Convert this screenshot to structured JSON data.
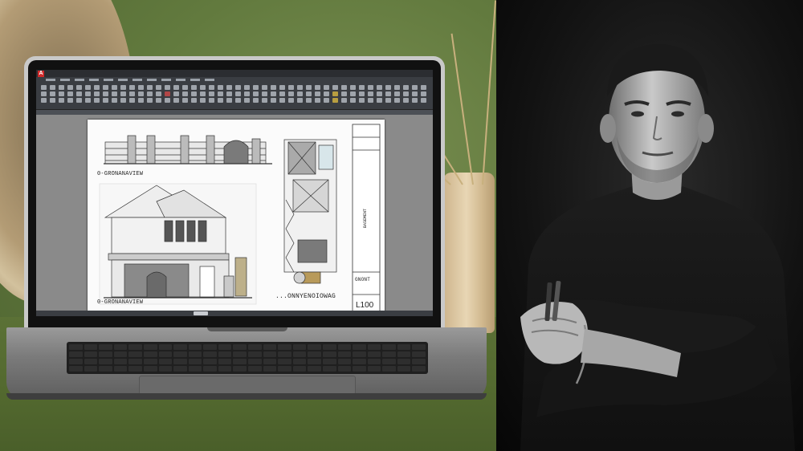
{
  "screen": {
    "app_logo": "A",
    "sheet": {
      "elevation_top_label": "0-GRONANAVIEW",
      "elevation_front_label": "0-GRONANAVIEW",
      "plan_label": "...ONNYENOIOWAG",
      "title_block_label": "GNONT",
      "vertical_title": "BASEMENT",
      "sheet_number": "L100"
    }
  },
  "colors": {
    "wall_green": "#627a3e",
    "cad_ribbon": "#3a3d42",
    "sheet_paper": "#fbfbfb",
    "autocad_red": "#d02a2a"
  }
}
